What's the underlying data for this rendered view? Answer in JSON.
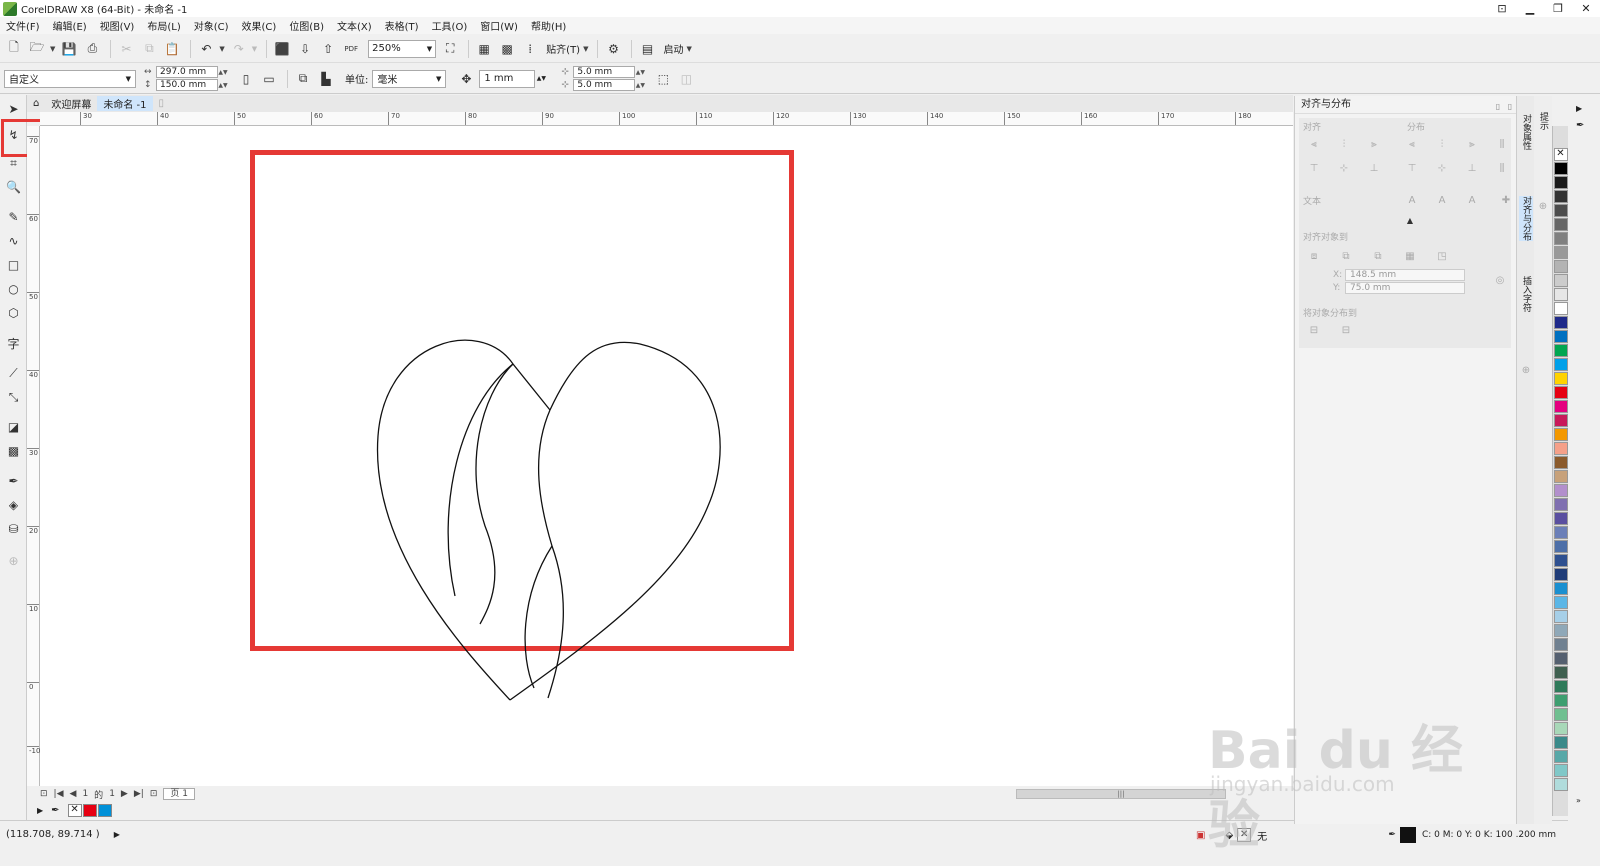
{
  "window": {
    "title": "CorelDRAW X8 (64-Bit) - 未命名 -1",
    "controls": [
      "▁",
      "❐",
      "✕"
    ]
  },
  "menu": [
    "文件(F)",
    "编辑(E)",
    "视图(V)",
    "布局(L)",
    "对象(C)",
    "效果(C)",
    "位图(B)",
    "文本(X)",
    "表格(T)",
    "工具(O)",
    "窗口(W)",
    "帮助(H)"
  ],
  "toolbar": {
    "zoom": "250%",
    "snap_label": "贴齐(T)",
    "launch_label": "启动",
    "pdf_label": "PDF"
  },
  "propertybar": {
    "preset": "自定义",
    "width": "297.0 mm",
    "height": "150.0 mm",
    "unit_label": "单位:",
    "unit_value": "毫米",
    "nudge": "1 mm",
    "dup_x": "5.0 mm",
    "dup_y": "5.0 mm"
  },
  "tabs": {
    "welcome": "欢迎屏幕",
    "document": "未命名 -1"
  },
  "ruler": {
    "h_ticks": [
      "30",
      "40",
      "50",
      "60",
      "70",
      "80",
      "90",
      "100",
      "110",
      "120",
      "130",
      "140",
      "150",
      "160",
      "170",
      "180"
    ],
    "v_ticks": [
      "70",
      "60",
      "50",
      "40",
      "30",
      "20",
      "10",
      "0",
      "-10",
      "-20",
      "-30"
    ]
  },
  "page_nav": {
    "current": "1",
    "of": "的",
    "total": "1",
    "page_tab": "页 1"
  },
  "status": {
    "coords": "(118.708, 89.714 )",
    "fill_none": "无",
    "outline_info": "C: 0 M: 0 Y: 0 K: 100  .200 mm"
  },
  "docker": {
    "title": "对齐与分布",
    "align_label": "对齐",
    "distribute_label": "分布",
    "text_label": "文本",
    "align_to_label": "对齐对象到",
    "x_value": "148.5 mm",
    "y_value": "75.0 mm",
    "x_label": "X:",
    "y_label": "Y:",
    "distribute_to_label": "将对象分布到"
  },
  "vtabs": {
    "object_props": "对象属性",
    "align_distribute": "对齐与分布",
    "insert_char": "插入字符",
    "hints": "提示"
  },
  "colors": {
    "accent_red": "#e53935",
    "tab_active": "#cfe5fb",
    "palette": [
      "#ffffff",
      "#000000",
      "#1a1a1a",
      "#333333",
      "#4d4d4d",
      "#666666",
      "#808080",
      "#999999",
      "#b3b3b3",
      "#cccccc",
      "#e6e6e6",
      "#ffffff",
      "#1f2a8a",
      "#0070c0",
      "#00a651",
      "#00a0e9",
      "#ffd200",
      "#e60012",
      "#e4007f",
      "#c8195a",
      "#f39800",
      "#f5a089",
      "#8b5a2b",
      "#c7a17a",
      "#b28fcc",
      "#7f6fb0",
      "#5a4fa0",
      "#6b7fb8",
      "#4d6fa8",
      "#2e5090",
      "#1f3c78",
      "#1a8fd0",
      "#5bb6e6",
      "#a6cfe8",
      "#8fa8b8",
      "#6f8090",
      "#556070",
      "#3f6050",
      "#2f7a5a",
      "#3e9e70",
      "#6fbf90",
      "#a8d8b8",
      "#3a8a8a",
      "#58a8a8",
      "#80c8c8",
      "#b0dcdc"
    ]
  },
  "watermark": {
    "main": "Bai du 经验",
    "sub": "jingyan.baidu.com"
  }
}
